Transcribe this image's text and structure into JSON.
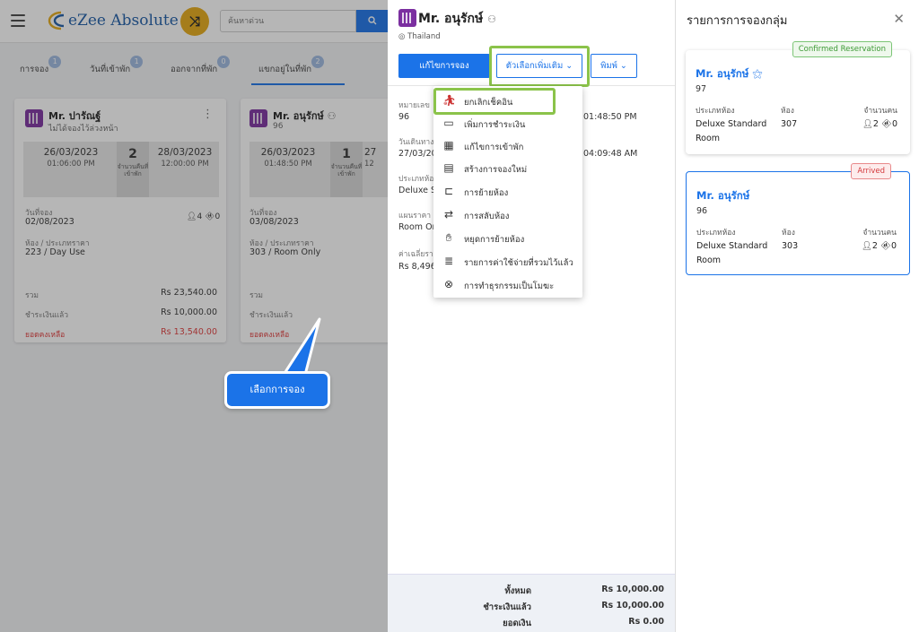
{
  "app": {
    "brand": "eZee Absolute",
    "search_placeholder": "ค้นหาด่วน",
    "search_icon": "search-icon",
    "tabs": [
      {
        "label": "การจอง",
        "count": "1"
      },
      {
        "label": "วันที่เข้าพัก",
        "count": "1"
      },
      {
        "label": "ออกจากที่พัก",
        "count": "0"
      },
      {
        "label": "แขกอยู่ในที่พัก",
        "count": "2"
      }
    ],
    "cards": [
      {
        "name": "Mr. ปารัณฐ์",
        "sub": "ไม่ได้จองไว้ล่วงหน้า",
        "checkin_date": "26/03/2023",
        "checkin_time": "01:06:00 PM",
        "nights": "2",
        "nights_label": "จำนวนคืนที่เข้าพัก",
        "checkout_date": "28/03/2023",
        "checkout_time": "12:00:00 PM",
        "booking_date_label": "วันที่จอง",
        "booking_date": "02/08/2023",
        "adults": "4",
        "children": "0",
        "room_rate_label": "ห้อง / ประเภทราคา",
        "room_rate": "223 / Day Use",
        "total_label": "รวม",
        "total": "Rs 23,540.00",
        "paid_label": "ชำระเงินแล้ว",
        "paid": "Rs 10,000.00",
        "balance_label": "ยอดคงเหลือ",
        "balance": "Rs 13,540.00"
      },
      {
        "name": "Mr. อนุรักษ์",
        "sub": "96",
        "checkin_date": "26/03/2023",
        "checkin_time": "01:48:50 PM",
        "nights": "1",
        "nights_label": "จำนวนคืนที่เข้าพัก",
        "checkout_date": "27",
        "checkout_time": "12",
        "booking_date_label": "วันที่จอง",
        "booking_date": "03/08/2023",
        "room_rate_label": "ห้อง / ประเภทราคา",
        "room_rate": "303 / Room Only",
        "total_label": "รวม",
        "paid_label": "ชำระเงินแล้ว",
        "balance_label": "ยอดคงเหลือ"
      }
    ],
    "callout": "เลือกการจอง"
  },
  "drawer": {
    "guest_name": "Mr. อนุรักษ์",
    "country": "Thailand",
    "edit_button": "แก้ไขการจอง",
    "more_button": "ตัวเลือกเพิ่มเติม",
    "print_button": "พิมพ์",
    "fields": [
      {
        "label": "หมายเลข",
        "value": "96",
        "time": "01:48:50 PM"
      },
      {
        "label": "วันเดินทาง",
        "value": "27/03/20",
        "time": "04:09:48 AM"
      },
      {
        "label": "ประเภทห้อง",
        "value": "Deluxe S"
      },
      {
        "label": "แผนราคา",
        "value": "Room On"
      },
      {
        "label": "ค่าเฉลี่ยรา",
        "value": "Rs 8,496"
      }
    ],
    "menu": [
      {
        "icon": "cancel-checkin-icon",
        "label": "ยกเลิกเช็คอิน"
      },
      {
        "icon": "add-payment-icon",
        "label": "เพิ่มการชำระเงิน"
      },
      {
        "icon": "edit-stay-icon",
        "label": "แก้ไขการเข้าพัก"
      },
      {
        "icon": "new-booking-icon",
        "label": "สร้างการจองใหม่"
      },
      {
        "icon": "move-room-icon",
        "label": "การย้ายห้อง"
      },
      {
        "icon": "swap-room-icon",
        "label": "การสลับห้อง"
      },
      {
        "icon": "stop-move-icon",
        "label": "หยุดการย้ายห้อง"
      },
      {
        "icon": "consolidated-expense-icon",
        "label": "รายการค่าใช้จ่ายที่รวมไว้แล้ว"
      },
      {
        "icon": "void-transaction-icon",
        "label": "การทำธุรกรรมเป็นโมฆะ"
      }
    ],
    "footer": {
      "total_label": "ทั้งหมด",
      "total": "Rs 10,000.00",
      "paid_label": "ชำระเงินแล้ว",
      "paid": "Rs 10,000.00",
      "balance_label": "ยอดเงิน",
      "balance": "Rs 0.00"
    }
  },
  "panel": {
    "title": "รายการการจองกลุ่ม",
    "room_type_label": "ประเภทห้อง",
    "room_label": "ห้อง",
    "pax_label": "จำนวนคน",
    "bookings": [
      {
        "status": "Confirmed Reservation",
        "name": "Mr. อนุรักษ์",
        "number": "97",
        "room_type": "Deluxe Standard Room",
        "room": "307",
        "adults": "2",
        "children": "0"
      },
      {
        "status": "Arrived",
        "name": "Mr. อนุรักษ์",
        "number": "96",
        "room_type": "Deluxe Standard Room",
        "room": "303",
        "adults": "2",
        "children": "0"
      }
    ]
  },
  "colors": {
    "primary": "#1b73e8",
    "highlight": "#8bc34a",
    "danger": "#e03b3b",
    "brand_yellow": "#e5a915",
    "hotel_icon": "#7b2fa0"
  }
}
